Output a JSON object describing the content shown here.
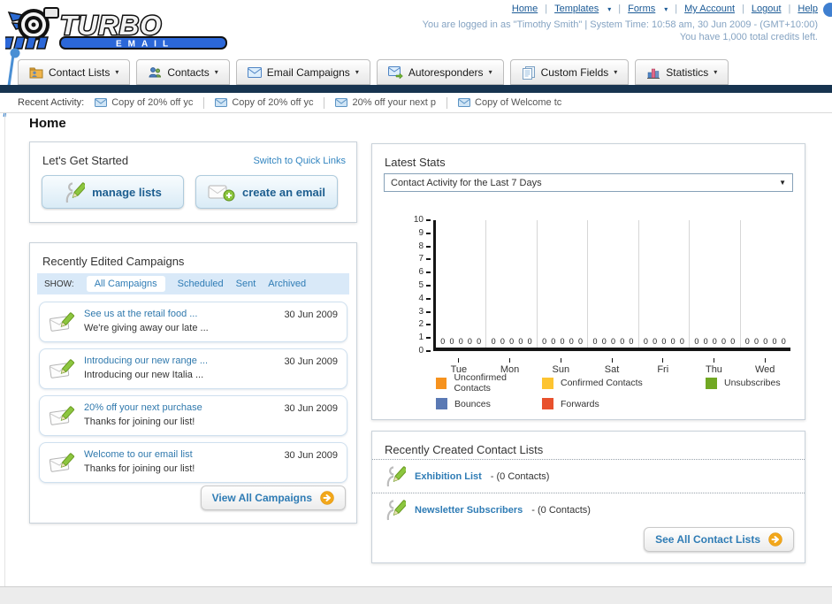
{
  "header": {
    "logo": {
      "title": "TURBO",
      "subtitle": "EMAIL"
    },
    "links": [
      {
        "label": "Home",
        "dropdown": false
      },
      {
        "label": "Templates",
        "dropdown": true
      },
      {
        "label": "Forms",
        "dropdown": true
      },
      {
        "label": "My Account",
        "dropdown": false
      },
      {
        "label": "Logout",
        "dropdown": false
      },
      {
        "label": "Help",
        "dropdown": false
      }
    ],
    "status_line1": "You are logged in as \"Timothy Smith\" | System Time: 10:58 am, 30 Jun 2009 - (GMT+10:00)",
    "status_line2": "You have 1,000 total credits left."
  },
  "nav": {
    "tabs": [
      {
        "label": "Contact Lists",
        "icon": "contact-lists-icon"
      },
      {
        "label": "Contacts",
        "icon": "contacts-icon"
      },
      {
        "label": "Email Campaigns",
        "icon": "email-campaigns-icon"
      },
      {
        "label": "Autoresponders",
        "icon": "autoresponders-icon"
      },
      {
        "label": "Custom Fields",
        "icon": "custom-fields-icon"
      },
      {
        "label": "Statistics",
        "icon": "statistics-icon"
      }
    ]
  },
  "recent_activity": {
    "label": "Recent Activity:",
    "items": [
      "Copy of 20% off yc",
      "Copy of 20% off yc",
      "20% off your next p",
      "Copy of Welcome tc"
    ]
  },
  "page_title": "Home",
  "get_started": {
    "title": "Let's Get Started",
    "switch_link": "Switch to Quick Links",
    "buttons": [
      {
        "label": "manage lists",
        "icon": "person-pencil-icon"
      },
      {
        "label": "create an email",
        "icon": "create-email-icon"
      }
    ]
  },
  "campaigns_panel": {
    "title": "Recently Edited Campaigns",
    "show_label": "SHOW:",
    "filters": [
      {
        "label": "All Campaigns",
        "active": true
      },
      {
        "label": "Scheduled",
        "active": false
      },
      {
        "label": "Sent",
        "active": false
      },
      {
        "label": "Archived",
        "active": false
      }
    ],
    "items": [
      {
        "title": "See us at the retail food ...",
        "subtitle": "We're giving away our late ...",
        "date": "30 Jun 2009"
      },
      {
        "title": "Introducing our new range ...",
        "subtitle": "Introducing our new Italia ...",
        "date": "30 Jun 2009"
      },
      {
        "title": "20% off your next purchase",
        "subtitle": "Thanks for joining our list!",
        "date": "30 Jun 2009"
      },
      {
        "title": "Welcome to our email list",
        "subtitle": "Thanks for joining our list!",
        "date": "30 Jun 2009"
      }
    ],
    "view_all_label": "View All Campaigns"
  },
  "stats_panel": {
    "title": "Latest Stats",
    "dropdown_value": "Contact Activity for the Last 7 Days",
    "chart_data": {
      "type": "bar",
      "title": "Contact Activity for the Last 7 Days",
      "categories": [
        "Tue",
        "Mon",
        "Sun",
        "Sat",
        "Fri",
        "Thu",
        "Wed"
      ],
      "series": [
        {
          "name": "Unconfirmed Contacts",
          "color": "#f6921e",
          "values": [
            0,
            0,
            0,
            0,
            0,
            0,
            0
          ]
        },
        {
          "name": "Confirmed Contacts",
          "color": "#fdc431",
          "values": [
            0,
            0,
            0,
            0,
            0,
            0,
            0
          ]
        },
        {
          "name": "Unsubscribes",
          "color": "#71a823",
          "values": [
            0,
            0,
            0,
            0,
            0,
            0,
            0
          ]
        },
        {
          "name": "Bounces",
          "color": "#5a79b4",
          "values": [
            0,
            0,
            0,
            0,
            0,
            0,
            0
          ]
        },
        {
          "name": "Forwards",
          "color": "#e8512d",
          "values": [
            0,
            0,
            0,
            0,
            0,
            0,
            0
          ]
        }
      ],
      "ylim": [
        0,
        10
      ],
      "yticks": [
        0,
        1,
        2,
        3,
        4,
        5,
        6,
        7,
        8,
        9,
        10
      ],
      "grid": "vertical-between-groups",
      "legend_position": "bottom"
    }
  },
  "contact_lists_panel": {
    "title": "Recently Created Contact Lists",
    "items": [
      {
        "name": "Exhibition List",
        "count": "- (0 Contacts)"
      },
      {
        "name": "Newsletter Subscribers",
        "count": "- (0 Contacts)"
      }
    ],
    "see_all_label": "See All Contact Lists"
  },
  "colors": {
    "navbar_dark": "#173450",
    "link_blue": "#2f7cb5",
    "header_link": "#1b5a96",
    "status_text": "#85a3c2",
    "panel_border": "#c9d2da",
    "show_bar_bg": "#d9e9f8",
    "button_text": "#1d5e8f",
    "orange_accent": "#f2a71b",
    "logo_blue": "#2b67d8"
  }
}
